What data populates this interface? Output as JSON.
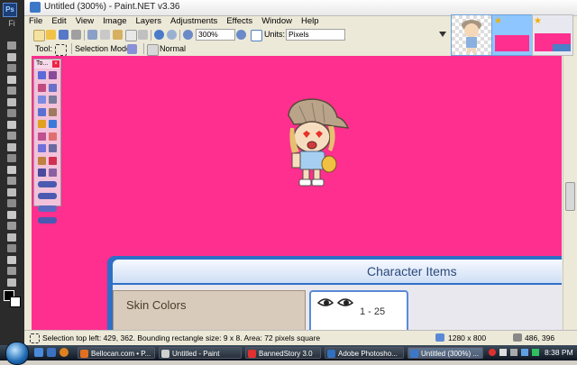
{
  "photoshop_strip": {
    "logo": "Ps",
    "top_label": "Fi",
    "tools": [
      "move-icon",
      "marquee-icon",
      "lasso-icon",
      "magic-wand-icon",
      "crop-icon",
      "slice-icon",
      "healing-icon",
      "brush-icon",
      "stamp-icon",
      "history-brush-icon",
      "eraser-icon",
      "gradient-icon",
      "blur-icon",
      "dodge-icon",
      "pen-icon",
      "type-icon",
      "path-select-icon",
      "shape-icon",
      "notes-icon",
      "eyedropper-icon",
      "hand-icon",
      "zoom-icon"
    ]
  },
  "window": {
    "title": "Untitled (300%) - Paint.NET v3.36"
  },
  "menu": [
    "File",
    "Edit",
    "View",
    "Image",
    "Layers",
    "Adjustments",
    "Effects",
    "Window",
    "Help"
  ],
  "toolbar": {
    "zoom_value": "300%",
    "units_label": "Units:",
    "units_value": "Pixels",
    "tool_label": "Tool:",
    "selection_mode_label": "Selection Mode:",
    "blend_mode_value": "Normal"
  },
  "canvas": {
    "background_color": "#ff2f8f"
  },
  "tools_window": {
    "title": "To..."
  },
  "character_panel": {
    "title": "Character Items",
    "skin_colors_label": "Skin Colors",
    "face_range": "1 - 25"
  },
  "status": {
    "text": "Selection top left: 429, 362. Bounding rectangle size: 9 x 8. Area: 72 pixels square",
    "image_size": "1280 x 800",
    "cursor": "486, 396"
  },
  "taskbar": {
    "items": [
      {
        "label": "Bellocan.com • P...",
        "color": "#e07020"
      },
      {
        "label": "Untitled - Paint",
        "color": "#d0d0d0"
      },
      {
        "label": "BannedStory 3.0",
        "color": "#e03030"
      },
      {
        "label": "Adobe Photosho...",
        "color": "#3070c0"
      },
      {
        "label": "Untitled (300%) ...",
        "color": "#3c78c8",
        "active": true
      }
    ],
    "clock": "8:38 PM"
  }
}
